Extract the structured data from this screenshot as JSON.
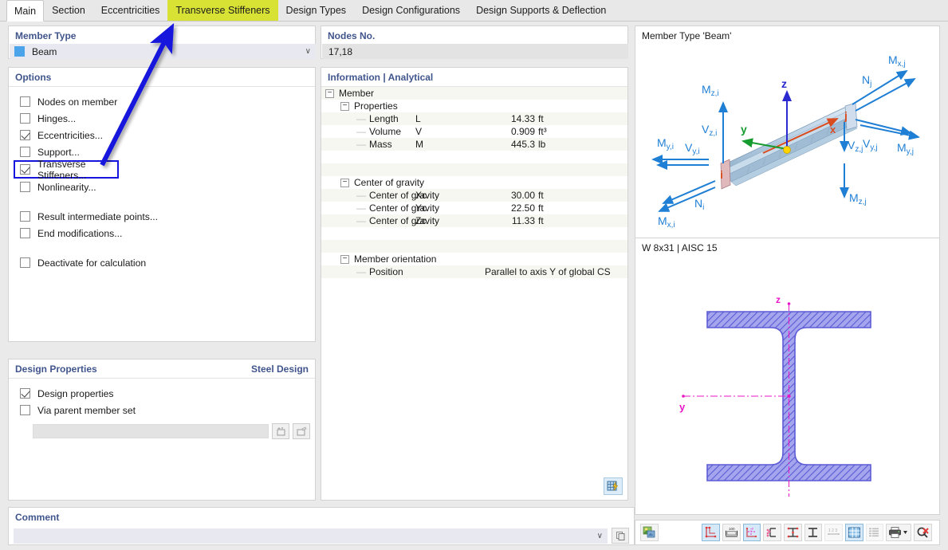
{
  "tabs": [
    {
      "label": "Main",
      "state": "active"
    },
    {
      "label": "Section",
      "state": "normal"
    },
    {
      "label": "Eccentricities",
      "state": "normal"
    },
    {
      "label": "Transverse Stiffeners",
      "state": "highlight"
    },
    {
      "label": "Design Types",
      "state": "normal"
    },
    {
      "label": "Design Configurations",
      "state": "normal"
    },
    {
      "label": "Design Supports & Deflection",
      "state": "normal"
    }
  ],
  "member_type": {
    "title": "Member Type",
    "value": "Beam",
    "swatch_color": "#4ba3ea",
    "chevron": "∨"
  },
  "options": {
    "title": "Options",
    "items": [
      {
        "label": "Nodes on member",
        "checked": false,
        "boxed": false
      },
      {
        "label": "Hinges...",
        "checked": false,
        "boxed": false
      },
      {
        "label": "Eccentricities...",
        "checked": true,
        "boxed": false
      },
      {
        "label": "Support...",
        "checked": false,
        "boxed": false
      },
      {
        "label": "Transverse Stiffeners...",
        "checked": true,
        "boxed": true
      },
      {
        "label": "Nonlinearity...",
        "checked": false,
        "boxed": false
      },
      {
        "label": "Result intermediate points...",
        "checked": false,
        "boxed": false
      },
      {
        "label": "End modifications...",
        "checked": false,
        "boxed": false
      },
      {
        "label": "Deactivate for calculation",
        "checked": false,
        "boxed": false
      }
    ],
    "highlight_border_color": "#1515dd"
  },
  "design_properties": {
    "title": "Design Properties",
    "right_label": "Steel Design",
    "items": [
      {
        "label": "Design properties",
        "checked": true
      },
      {
        "label": "Via parent member set",
        "checked": false
      }
    ],
    "input_value": "",
    "buttons": [
      "new-parent-member-set-button",
      "edit-parent-member-set-button"
    ]
  },
  "comment": {
    "title": "Comment",
    "value": "",
    "chevron": "∨"
  },
  "nodes": {
    "title": "Nodes No.",
    "value": "17,18"
  },
  "information": {
    "title": "Information | Analytical",
    "root": "Member",
    "groups": [
      {
        "name": "Properties",
        "rows": [
          {
            "name": "Length",
            "symbol": "L",
            "value": "14.33",
            "unit": "ft"
          },
          {
            "name": "Volume",
            "symbol": "V",
            "value": "0.909",
            "unit": "ft³"
          },
          {
            "name": "Mass",
            "symbol": "M",
            "value": "445.3",
            "unit": "lb"
          }
        ]
      },
      {
        "name": "Center of gravity",
        "rows": [
          {
            "name": "Center of gravity",
            "symbol": "Xc",
            "value": "30.00",
            "unit": "ft"
          },
          {
            "name": "Center of gravity",
            "symbol": "Yc",
            "value": "22.50",
            "unit": "ft"
          },
          {
            "name": "Center of gravity",
            "symbol": "Zc",
            "value": "11.33",
            "unit": "ft"
          }
        ]
      },
      {
        "name": "Member orientation",
        "rows": [
          {
            "name": "Position",
            "symbol": "",
            "value": "",
            "unit": "",
            "text": "Parallel to axis Y of global CS"
          }
        ]
      }
    ],
    "grid_icon": "table-lightning-icon"
  },
  "beam_preview": {
    "title": "Member Type 'Beam'",
    "axis_labels": {
      "x": "x",
      "y": "y",
      "z": "z",
      "start_node": "i",
      "end_node": "j"
    },
    "force_labels_i": [
      "M z,i",
      "V z,i",
      "M y,i",
      "V y,i",
      "N i",
      "M x,i"
    ],
    "force_labels_j": [
      "M x,j",
      "N j",
      "V y,j",
      "M y,j",
      "V z,j",
      "M z,j"
    ],
    "colors": {
      "force_arrow": "#1f7fd4",
      "x_axis": "#d94c20",
      "y_axis": "#169c2e",
      "z_axis": "#2a2ad0",
      "origin": "#ffd400"
    }
  },
  "section_preview": {
    "title": "W 8x31 | AISC 15",
    "axis_y_label": "y",
    "axis_z_label": "z",
    "section_color": "#6b6bdd",
    "axis_color": "#e916c8"
  },
  "right_toolbar": {
    "buttons": [
      {
        "name": "render-view-button",
        "state": "normal"
      },
      {
        "name": "section-outline-button",
        "state": "selected"
      },
      {
        "name": "dimensions-button",
        "state": "normal"
      },
      {
        "name": "principal-axes-button",
        "state": "selected"
      },
      {
        "name": "stress-points-button",
        "state": "normal"
      },
      {
        "name": "section-parts-button",
        "state": "normal"
      },
      {
        "name": "section-shape-button",
        "state": "normal"
      },
      {
        "name": "numbering-button",
        "state": "disabled"
      },
      {
        "name": "grid-button",
        "state": "selected"
      },
      {
        "name": "value-list-button",
        "state": "disabled"
      },
      {
        "name": "print-button",
        "state": "normal"
      },
      {
        "name": "zoom-reset-button",
        "state": "normal"
      }
    ]
  },
  "annotation": {
    "arrow_color": "#1515dd",
    "from": [
      128,
      207
    ],
    "to": [
      212,
      42
    ]
  }
}
